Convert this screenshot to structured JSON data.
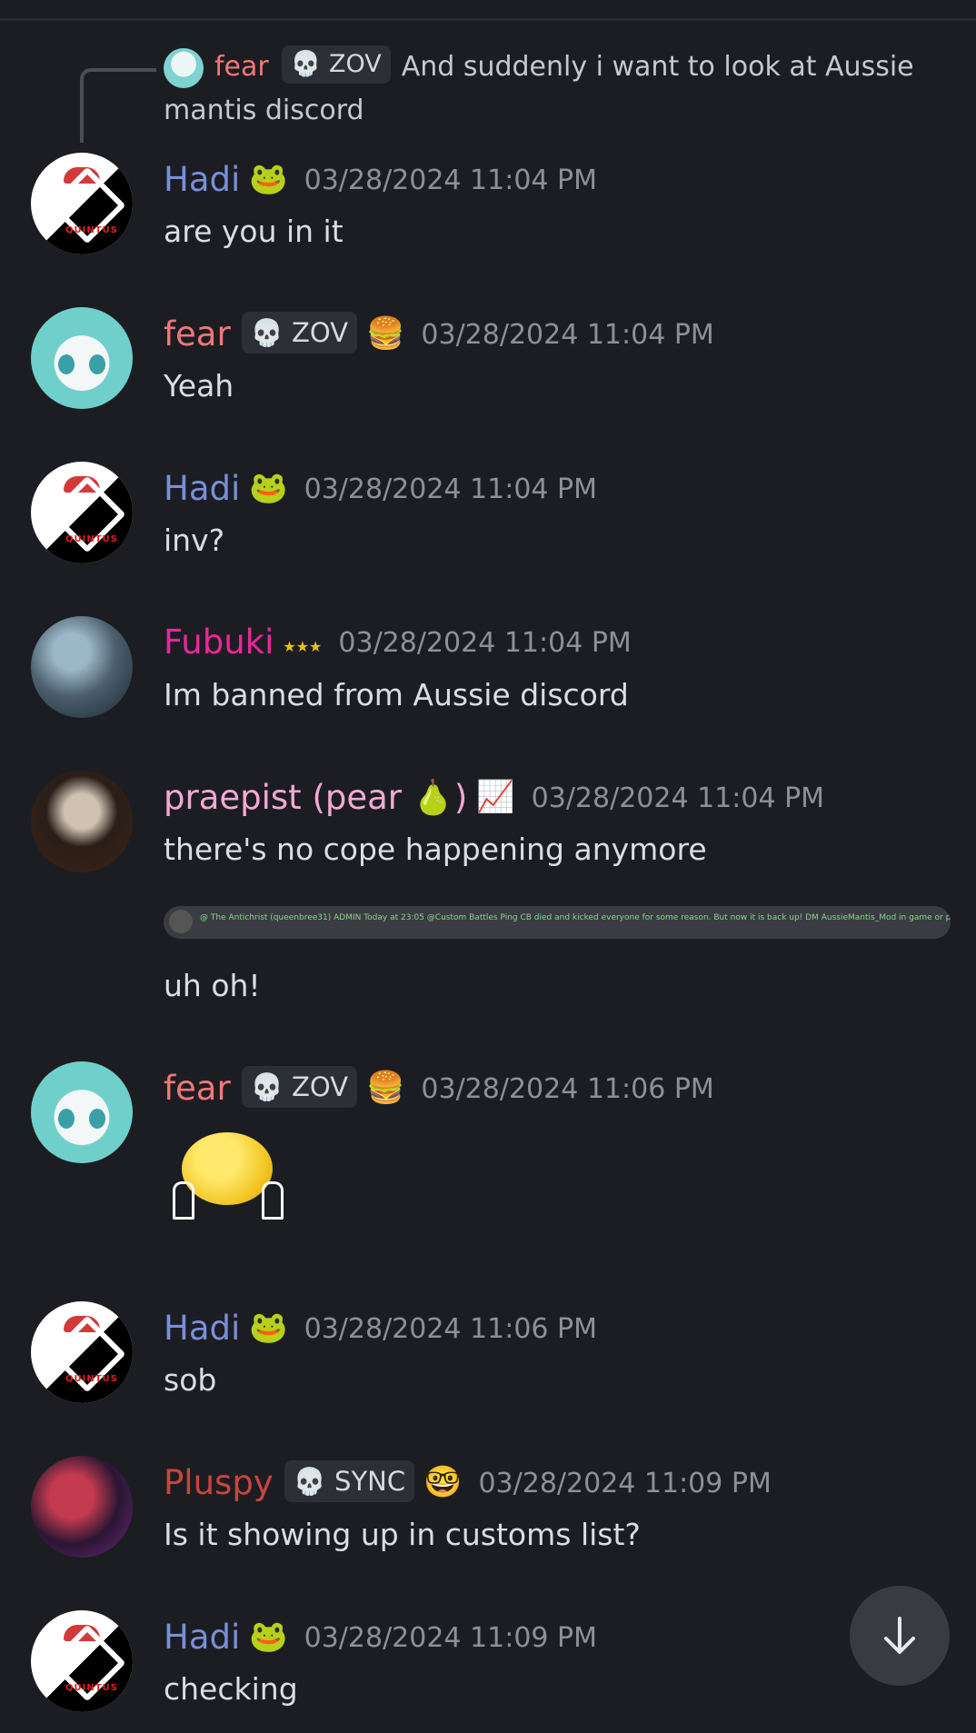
{
  "reply_preview": {
    "author": "fear",
    "badge": "ZOV",
    "text": "And suddenly i want to look at Aussie mantis discord"
  },
  "messages": [
    {
      "author": "Hadi",
      "timestamp": "03/28/2024 11:04 PM",
      "text": "are you in it"
    },
    {
      "author": "fear",
      "badge": "ZOV",
      "timestamp": "03/28/2024 11:04 PM",
      "text": "Yeah"
    },
    {
      "author": "Hadi",
      "timestamp": "03/28/2024 11:04 PM",
      "text": "inv?"
    },
    {
      "author": "Fubuki",
      "timestamp": "03/28/2024 11:04 PM",
      "text": "Im banned from Aussie discord"
    },
    {
      "author": "praepist (pear 🍐)",
      "timestamp": "03/28/2024 11:04 PM",
      "text": "there's no cope happening anymore",
      "text2": "uh oh!"
    },
    {
      "author": "fear",
      "badge": "ZOV",
      "timestamp": "03/28/2024 11:06 PM",
      "text": ""
    },
    {
      "author": "Hadi",
      "timestamp": "03/28/2024 11:06 PM",
      "text": "sob"
    },
    {
      "author": "Pluspy",
      "badge": "SYNC",
      "timestamp": "03/28/2024 11:09 PM",
      "text": "Is it showing up in customs list?"
    },
    {
      "author": "Hadi",
      "timestamp": "03/28/2024 11:09 PM",
      "text": "checking"
    }
  ],
  "embed": {
    "text": "@ The Antichrist (queenbree31) ADMIN Today at 23:05 @Custom Battles Ping CB died and kicked everyone for some reason. But now it is back up! DM AussieMantis_Mod in game or ping @Gud bevare Danmark, pizzaDK in # cb-mod-request to get an invite"
  },
  "icons": {
    "badge_icon": "skull-icon",
    "scroll_button": "arrow-down-icon"
  }
}
